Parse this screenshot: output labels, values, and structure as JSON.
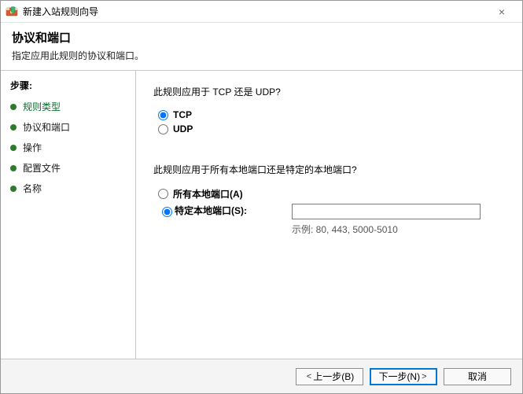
{
  "window": {
    "title": "新建入站规则向导",
    "close_label": "×"
  },
  "header": {
    "title": "协议和端口",
    "subtitle": "指定应用此规则的协议和端口。"
  },
  "steps": {
    "title": "步骤:",
    "items": [
      {
        "label": "规则类型",
        "link": true
      },
      {
        "label": "协议和端口",
        "link": false
      },
      {
        "label": "操作",
        "link": false
      },
      {
        "label": "配置文件",
        "link": false
      },
      {
        "label": "名称",
        "link": false
      }
    ]
  },
  "content": {
    "proto_question": "此规则应用于 TCP 还是 UDP?",
    "tcp_label": "TCP",
    "udp_label": "UDP",
    "port_question": "此规则应用于所有本地端口还是特定的本地端口?",
    "all_ports_label": "所有本地端口(A)",
    "specific_ports_label": "特定本地端口(S):",
    "port_value": "",
    "example_label": "示例: 80, 443, 5000-5010"
  },
  "footer": {
    "back": "上一步(B)",
    "next": "下一步(N)",
    "cancel": "取消"
  }
}
